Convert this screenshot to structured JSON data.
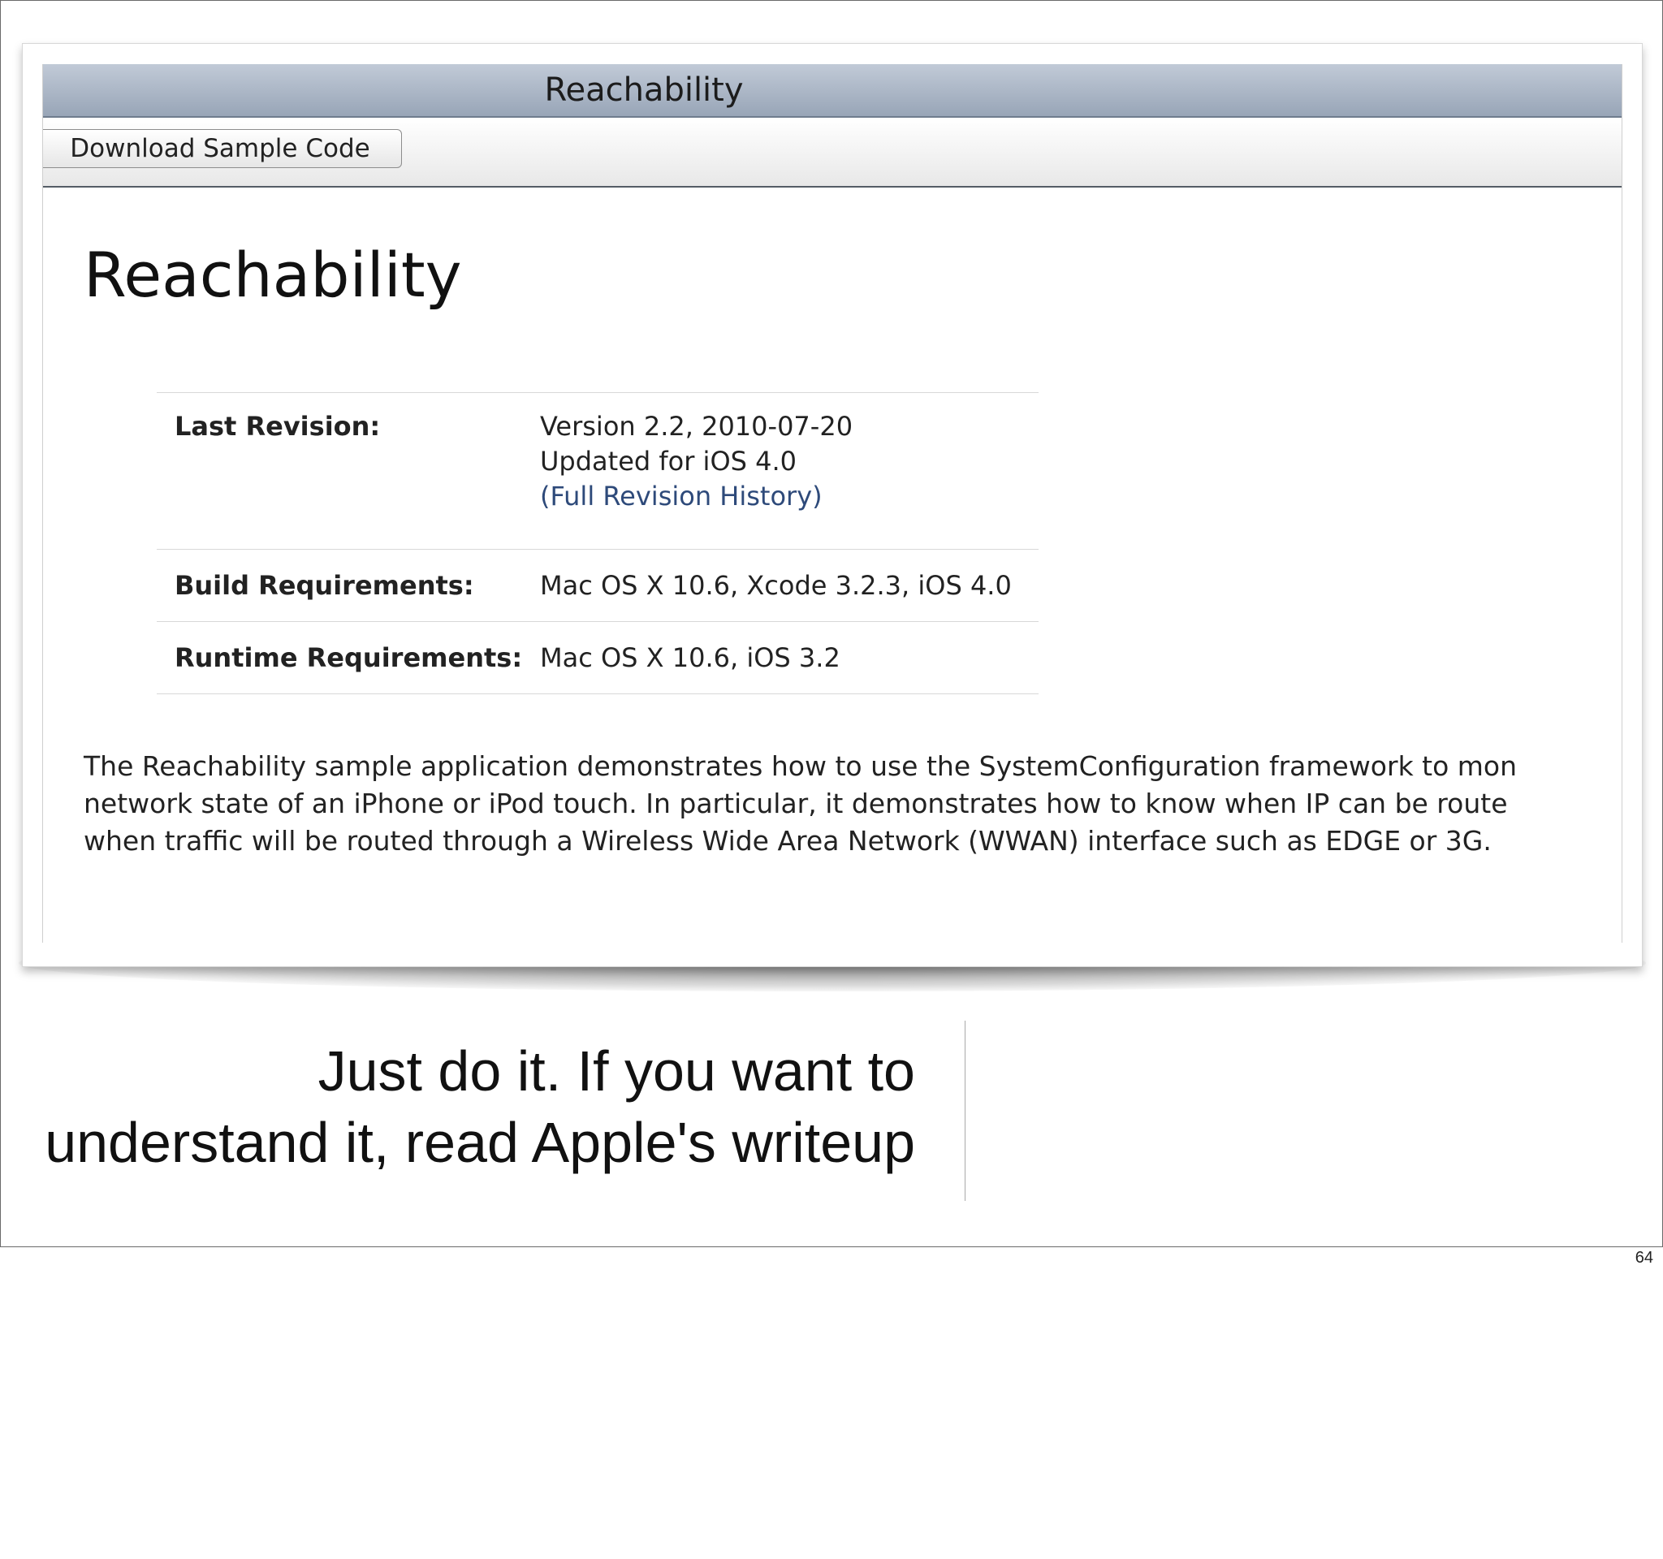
{
  "window": {
    "title": "Reachability"
  },
  "toolbar": {
    "download_label": "Download Sample Code"
  },
  "page": {
    "heading": "Reachability"
  },
  "info": {
    "last_revision_label": "Last Revision:",
    "last_revision_version": "Version 2.2, 2010-07-20",
    "last_revision_note": "Updated for iOS 4.0",
    "revision_history_link": "(Full Revision History)",
    "build_label": "Build Requirements:",
    "build_value": "Mac OS X 10.6, Xcode 3.2.3, iOS 4.0",
    "runtime_label": "Runtime Requirements:",
    "runtime_value": "Mac OS X 10.6, iOS 3.2"
  },
  "description": {
    "lines": [
      "The Reachability sample application demonstrates how to use the SystemConfiguration framework to mon",
      "network state of an iPhone or iPod touch. In particular, it demonstrates how to know when IP can be route",
      "when traffic will be routed through a Wireless Wide Area Network (WWAN) interface such as EDGE or 3G."
    ]
  },
  "caption": {
    "line1": "Just do it.  If you want to",
    "line2": "understand it, read Apple's writeup"
  },
  "slide": {
    "number": "64"
  }
}
